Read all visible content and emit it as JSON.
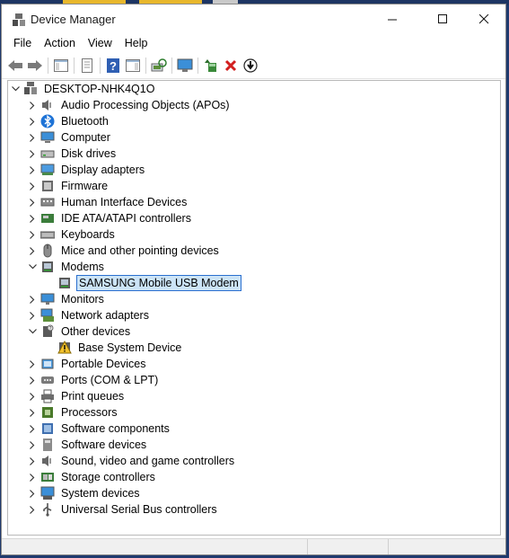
{
  "window": {
    "title": "Device Manager"
  },
  "menu": [
    "File",
    "Action",
    "View",
    "Help"
  ],
  "toolbar": [
    {
      "name": "back-button",
      "icon": "arrow-left-icon"
    },
    {
      "name": "forward-button",
      "icon": "arrow-right-icon"
    },
    {
      "name": "show-hide-console-tree-button",
      "icon": "console-tree-icon"
    },
    {
      "name": "properties-button",
      "icon": "properties-icon"
    },
    {
      "name": "help-button",
      "icon": "help-icon"
    },
    {
      "name": "show-action-pane-button",
      "icon": "action-pane-icon"
    },
    {
      "name": "scan-hardware-changes-button",
      "icon": "scan-hardware-icon"
    },
    {
      "name": "monitor-button",
      "icon": "monitor-icon"
    },
    {
      "name": "update-driver-button",
      "icon": "update-driver-icon"
    },
    {
      "name": "uninstall-device-button",
      "icon": "red-x-icon"
    },
    {
      "name": "disable-device-button",
      "icon": "download-arrow-icon"
    }
  ],
  "tree": {
    "root": "DESKTOP-NHK4Q1O",
    "items": [
      {
        "label": "Audio Processing Objects (APOs)",
        "icon": "speaker-icon",
        "expanded": false
      },
      {
        "label": "Bluetooth",
        "icon": "bluetooth-icon",
        "expanded": false
      },
      {
        "label": "Computer",
        "icon": "computer-icon",
        "expanded": false
      },
      {
        "label": "Disk drives",
        "icon": "disk-drive-icon",
        "expanded": false
      },
      {
        "label": "Display adapters",
        "icon": "display-adapter-icon",
        "expanded": false
      },
      {
        "label": "Firmware",
        "icon": "firmware-icon",
        "expanded": false
      },
      {
        "label": "Human Interface Devices",
        "icon": "hid-icon",
        "expanded": false
      },
      {
        "label": "IDE ATA/ATAPI controllers",
        "icon": "ide-controller-icon",
        "expanded": false
      },
      {
        "label": "Keyboards",
        "icon": "keyboard-icon",
        "expanded": false
      },
      {
        "label": "Mice and other pointing devices",
        "icon": "mouse-icon",
        "expanded": false
      },
      {
        "label": "Modems",
        "icon": "modem-icon",
        "expanded": true,
        "children": [
          {
            "label": "SAMSUNG Mobile USB Modem",
            "icon": "modem-icon",
            "selected": true
          }
        ]
      },
      {
        "label": "Monitors",
        "icon": "monitor-icon",
        "expanded": false
      },
      {
        "label": "Network adapters",
        "icon": "network-adapter-icon",
        "expanded": false
      },
      {
        "label": "Other devices",
        "icon": "unknown-device-icon",
        "expanded": true,
        "children": [
          {
            "label": "Base System Device",
            "icon": "warning-device-icon",
            "selected": false
          }
        ]
      },
      {
        "label": "Portable Devices",
        "icon": "portable-device-icon",
        "expanded": false
      },
      {
        "label": "Ports (COM & LPT)",
        "icon": "port-icon",
        "expanded": false
      },
      {
        "label": "Print queues",
        "icon": "printer-icon",
        "expanded": false
      },
      {
        "label": "Processors",
        "icon": "processor-icon",
        "expanded": false
      },
      {
        "label": "Software components",
        "icon": "software-component-icon",
        "expanded": false
      },
      {
        "label": "Software devices",
        "icon": "software-device-icon",
        "expanded": false
      },
      {
        "label": "Sound, video and game controllers",
        "icon": "speaker-icon",
        "expanded": false
      },
      {
        "label": "Storage controllers",
        "icon": "storage-controller-icon",
        "expanded": false
      },
      {
        "label": "System devices",
        "icon": "system-device-icon",
        "expanded": false
      },
      {
        "label": "Universal Serial Bus controllers",
        "icon": "usb-icon",
        "expanded": false
      }
    ]
  }
}
